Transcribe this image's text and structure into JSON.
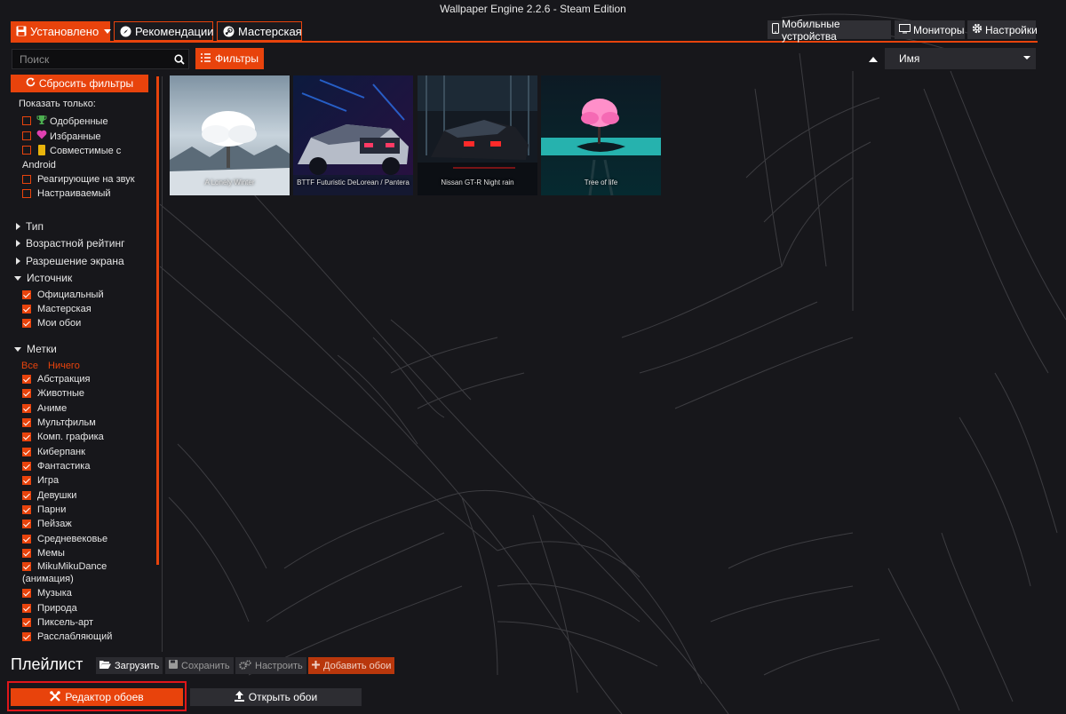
{
  "window": {
    "title": "Wallpaper Engine 2.2.6 - Steam Edition"
  },
  "tabs": [
    {
      "label": "Установлено",
      "icon": "floppy-disk-icon",
      "active": true
    },
    {
      "label": "Рекомендации",
      "icon": "compass-icon",
      "active": false
    },
    {
      "label": "Мастерская",
      "icon": "steam-icon",
      "active": false
    }
  ],
  "top_right": [
    {
      "label": "Мобильные устройства",
      "icon": "mobile-phone-icon"
    },
    {
      "label": "Мониторы",
      "icon": "monitor-icon"
    },
    {
      "label": "Настройки",
      "icon": "gear-icon"
    }
  ],
  "search": {
    "placeholder": "Поиск",
    "value": ""
  },
  "filters_button": {
    "label": "Фильтры",
    "icon": "filter-list-icon"
  },
  "sort": {
    "value": "Имя",
    "direction": "ascending"
  },
  "sidebar": {
    "reset_label": "Сбросить фильтры",
    "show_only_label": "Показать только:",
    "show_only": [
      {
        "label": "Одобренные",
        "icon": "trophy-icon",
        "checked": false
      },
      {
        "label": "Избранные",
        "icon": "heart-icon",
        "checked": false
      },
      {
        "label": "Совместимые с",
        "label2": "Android",
        "icon": "mobile-icon",
        "checked": false
      },
      {
        "label": "Реагирующие на звук",
        "checked": false
      },
      {
        "label": "Настраиваемый",
        "checked": false
      }
    ],
    "sections": [
      {
        "label": "Тип",
        "expanded": false
      },
      {
        "label": "Возрастной рейтинг",
        "expanded": false
      },
      {
        "label": "Разрешение экрана",
        "expanded": false
      },
      {
        "label": "Источник",
        "expanded": true
      },
      {
        "label": "Метки",
        "expanded": true
      }
    ],
    "source_items": [
      {
        "label": "Официальный",
        "checked": true
      },
      {
        "label": "Мастерская",
        "checked": true
      },
      {
        "label": "Мои обои",
        "checked": true
      }
    ],
    "tags_all": "Все",
    "tags_none": "Ничего",
    "tags": [
      {
        "label": "Абстракция",
        "checked": true
      },
      {
        "label": "Животные",
        "checked": true
      },
      {
        "label": "Аниме",
        "checked": true
      },
      {
        "label": "Мультфильм",
        "checked": true
      },
      {
        "label": "Комп. графика",
        "checked": true
      },
      {
        "label": "Киберпанк",
        "checked": true
      },
      {
        "label": "Фантастика",
        "checked": true
      },
      {
        "label": "Игра",
        "checked": true
      },
      {
        "label": "Девушки",
        "checked": true
      },
      {
        "label": "Парни",
        "checked": true
      },
      {
        "label": "Пейзаж",
        "checked": true
      },
      {
        "label": "Средневековье",
        "checked": true
      },
      {
        "label": "Мемы",
        "checked": true
      },
      {
        "label": "MikuMikuDance",
        "label2": "(анимация)",
        "checked": true
      },
      {
        "label": "Музыка",
        "checked": true
      },
      {
        "label": "Природа",
        "checked": true
      },
      {
        "label": "Пиксель-арт",
        "checked": true
      },
      {
        "label": "Расслабляющий",
        "checked": true
      }
    ]
  },
  "wallpapers": [
    {
      "title": "A Lonely Winter",
      "theme": "snowy-tree"
    },
    {
      "title": "BTTF Futuristic DeLorean / Pantera",
      "theme": "neon-car"
    },
    {
      "title": "Nissan GT-R Night rain",
      "theme": "night-car"
    },
    {
      "title": "Tree of life",
      "theme": "pink-tree"
    }
  ],
  "playlist": {
    "title": "Плейлист",
    "buttons": [
      {
        "label": "Загрузить",
        "icon": "folder-open-icon",
        "enabled": true
      },
      {
        "label": "Сохранить",
        "icon": "floppy-disk-icon",
        "enabled": false
      },
      {
        "label": "Настроить",
        "icon": "cogs-icon",
        "enabled": false
      },
      {
        "label": "Добавить обои",
        "icon": "plus-icon",
        "enabled": false
      }
    ]
  },
  "bottom": {
    "editor_label": "Редактор обоев",
    "editor_icon": "wrench-icon",
    "open_label": "Открыть обои",
    "open_icon": "upload-icon"
  },
  "colors": {
    "accent": "#e8430c",
    "background": "#17171b",
    "highlight_frame": "#e0161a"
  }
}
